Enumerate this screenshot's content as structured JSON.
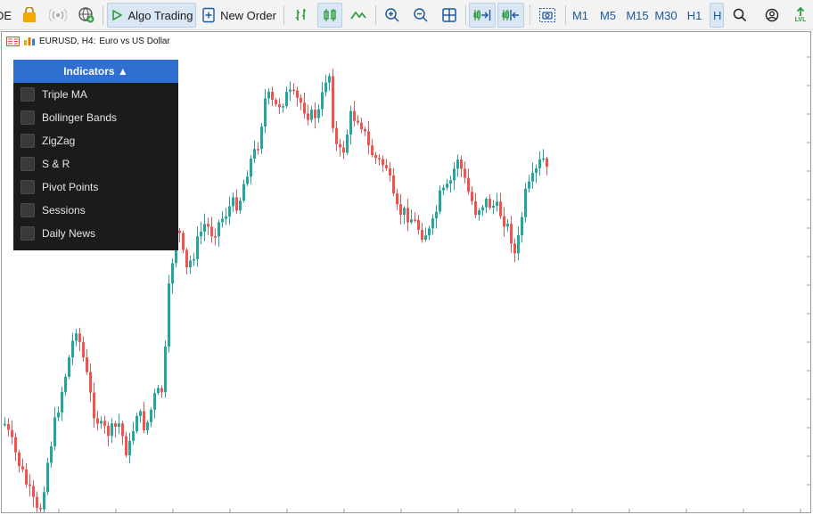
{
  "toolbar": {
    "partial_label": "DE",
    "algo_trading_label": "Algo Trading",
    "new_order_label": "New Order",
    "timeframes": [
      "M1",
      "M5",
      "M15",
      "M30",
      "H1",
      "H"
    ],
    "icons": [
      "bag-icon",
      "signal-icon",
      "globe-icon",
      "play-icon",
      "new-order-icon",
      "bar-chart-icon",
      "candlestick-icon",
      "line-chart-icon",
      "zoom-in-icon",
      "zoom-out-icon",
      "grid-icon",
      "autoscroll-icon",
      "chart-shift-icon",
      "screenshot-icon",
      "search-icon",
      "account-icon",
      "level-icon"
    ],
    "level_label": "LVL"
  },
  "chart": {
    "symbol_label": "EURUSD, H4:",
    "description": "Euro vs US Dollar",
    "bull_color": "#26a69a",
    "bear_color": "#ef5350"
  },
  "indicators_panel": {
    "title": "Indicators ▲",
    "items": [
      "Triple MA",
      "Bollinger Bands",
      "ZigZag",
      "S & R",
      "Pivot Points",
      "Sessions",
      "Daily News"
    ]
  }
}
